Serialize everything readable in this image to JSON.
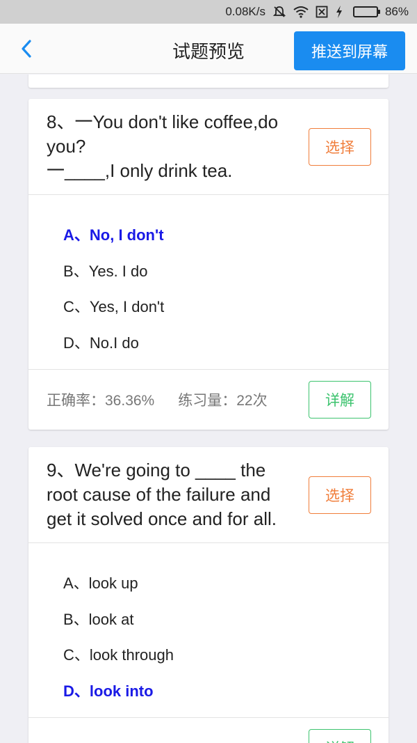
{
  "status_bar": {
    "speed": "0.08K/s",
    "battery": "86%",
    "battery_level": 0.86,
    "icons": [
      "mute-icon",
      "wifi-icon",
      "sim-icon",
      "charging-icon",
      "battery-icon"
    ]
  },
  "nav": {
    "title": "试题预览",
    "push_label": "推送到屏幕",
    "back_icon": "chevron-left-icon"
  },
  "colors": {
    "primary": "#1a8cf0",
    "select": "#f07d3a",
    "detail": "#3cc36e",
    "correct": "#1a1ae6"
  },
  "questions": [
    {
      "text": "8、一You don't like coffee,do you?\n一____,I only drink tea.",
      "select_label": "选择",
      "options": [
        {
          "text": "A、No, I don't",
          "correct": true
        },
        {
          "text": "B、Yes. I do",
          "correct": false
        },
        {
          "text": "C、Yes, I don't",
          "correct": false
        },
        {
          "text": "D、No.I do",
          "correct": false
        }
      ],
      "accuracy": "正确率：36.36%",
      "practice_count": "练习量：22次",
      "detail_label": "详解"
    },
    {
      "text": "9、We're going to ____ the root cause of the failure and get it solved once and for all.",
      "select_label": "选择",
      "options": [
        {
          "text": "A、look up",
          "correct": false
        },
        {
          "text": "B、look at",
          "correct": false
        },
        {
          "text": "C、look through",
          "correct": false
        },
        {
          "text": "D、look into",
          "correct": true
        }
      ],
      "detail_label": "详解"
    }
  ]
}
